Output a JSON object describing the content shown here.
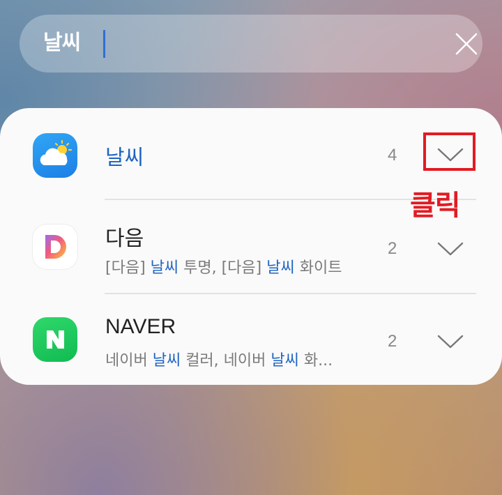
{
  "search": {
    "query": "날씨"
  },
  "results": [
    {
      "name": "날씨",
      "count": "4"
    },
    {
      "name": "다음",
      "count": "2",
      "subtitle": {
        "p1": "[다음] ",
        "h1": "날씨",
        "p2": " 투명, [다음] ",
        "h2": "날씨",
        "p3": " 화이트"
      }
    },
    {
      "name": "NAVER",
      "count": "2",
      "subtitle": {
        "p1": "네이버 ",
        "h1": "날씨",
        "p2": " 컬러, 네이버 ",
        "h2": "날씨",
        "p3": " 화..."
      }
    }
  ],
  "annotation": {
    "label": "클릭"
  },
  "colors": {
    "highlight": "#1e63c2",
    "annotation": "#e21b22"
  }
}
